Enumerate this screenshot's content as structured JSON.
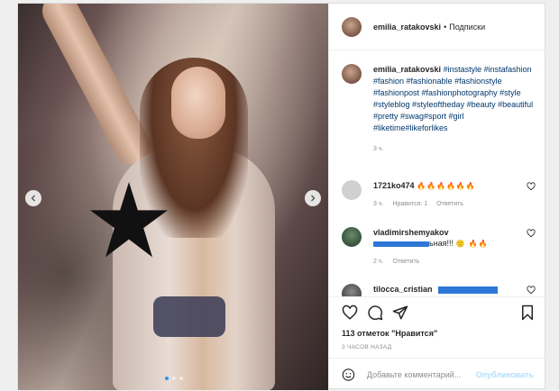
{
  "post": {
    "username": "emilia_ratakovski",
    "follow_label": "Подписки",
    "separator": "•",
    "slide_count": 3,
    "active_slide": 0
  },
  "caption": {
    "username": "emilia_ratakovski",
    "text": "#instastyle #instafashion #fashion #fashionable #fashionstyle #fashionpost #fashionphotography #style #styleblog #styleoftheday #beauty #beautiful #pretty #swag#sport #girl #liketime#likeforlikes",
    "time": "3 ч."
  },
  "comments": [
    {
      "username": "1721ko474",
      "emojis": "🔥🔥🔥🔥🔥🔥",
      "time": "3 ч.",
      "likes": "Нравится: 1",
      "reply": "Ответить"
    },
    {
      "username": "vladimirshemyakov",
      "text": "ьная!!!",
      "emojis": "🙂 🔥🔥",
      "time": "2 ч.",
      "reply": "Ответить"
    },
    {
      "username": "tilocca_cristian",
      "text": ""
    }
  ],
  "actions": {
    "likes_count": "113 отметок",
    "likes_suffix": "\"Нравится\"",
    "posted_ago": "3 ЧАСОВ НАЗАД"
  },
  "composer": {
    "placeholder": "Добавьте комментарий...",
    "publish": "Опубликовать"
  },
  "colors": {
    "link": "#00376b",
    "accent": "#2d90f0",
    "muted": "#8e8e8e",
    "publish_disabled": "#b2dffc"
  },
  "icons": [
    "heart-icon",
    "comment-icon",
    "share-icon",
    "bookmark-icon",
    "emoji-icon",
    "chevron-left-icon",
    "chevron-right-icon"
  ]
}
